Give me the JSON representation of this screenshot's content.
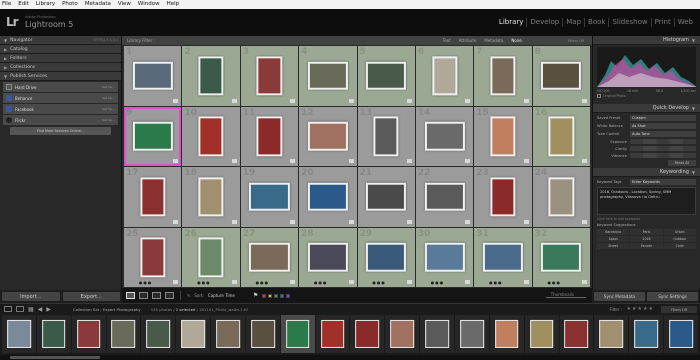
{
  "menu": [
    "File",
    "Edit",
    "Library",
    "Photo",
    "Metadata",
    "View",
    "Window",
    "Help"
  ],
  "identity": {
    "logo": "Lr",
    "small": "Adobe Photoshop",
    "name": "Lightroom 5"
  },
  "modules": [
    {
      "label": "Library",
      "active": true
    },
    {
      "label": "Develop",
      "active": false
    },
    {
      "label": "Map",
      "active": false
    },
    {
      "label": "Book",
      "active": false
    },
    {
      "label": "Slideshow",
      "active": false
    },
    {
      "label": "Print",
      "active": false
    },
    {
      "label": "Web",
      "active": false
    }
  ],
  "left_panel": {
    "navigator": {
      "title": "Navigator",
      "fit": "FIT  FILL  1:1  3:1"
    },
    "sections": [
      "Catalog",
      "Folders",
      "Collections",
      "Publish Services"
    ],
    "services": [
      {
        "label": "Hard Drive",
        "set_up": "Set Up...",
        "icon": "hard-drive-icon"
      },
      {
        "label": "Behance",
        "set_up": "Set Up...",
        "icon": "behance-icon"
      },
      {
        "label": "Facebook",
        "set_up": "Set Up...",
        "icon": "facebook-icon"
      },
      {
        "label": "Flickr",
        "set_up": "Set Up...",
        "icon": "flickr-icon"
      }
    ],
    "find_more": "Find More Services Online..."
  },
  "left_buttons": {
    "import": "Import...",
    "export": "Export..."
  },
  "filter_bar": {
    "title": "Library Filter :",
    "options": [
      {
        "label": "Text",
        "on": false
      },
      {
        "label": "Attribute",
        "on": false
      },
      {
        "label": "Metadata",
        "on": false
      },
      {
        "label": "None",
        "on": true
      }
    ],
    "filters_off": "Filters Off"
  },
  "grid": {
    "cells": [
      {
        "num": "1",
        "photo": "#5a6a7a",
        "shape": "wide",
        "green": false
      },
      {
        "num": "2",
        "photo": "#3a5a4a",
        "shape": "tall",
        "green": true
      },
      {
        "num": "3",
        "photo": "#8b3a3a",
        "shape": "tall",
        "green": true
      },
      {
        "num": "4",
        "photo": "#6a6a5a",
        "shape": "wide",
        "green": true
      },
      {
        "num": "5",
        "photo": "#4a5a4a",
        "shape": "wide",
        "green": true
      },
      {
        "num": "6",
        "photo": "#b0a898",
        "shape": "tall",
        "green": true
      },
      {
        "num": "7",
        "photo": "#7a6a5a",
        "shape": "tall",
        "green": true
      },
      {
        "num": "8",
        "photo": "#5a5040",
        "shape": "wide",
        "green": true
      },
      {
        "num": "9",
        "photo": "#2a7a4a",
        "shape": "wide",
        "green": false,
        "highlight": true
      },
      {
        "num": "10",
        "photo": "#a03028",
        "shape": "tall",
        "green": false
      },
      {
        "num": "11",
        "photo": "#8a2a2a",
        "shape": "tall",
        "green": false
      },
      {
        "num": "12",
        "photo": "#a07060",
        "shape": "wide",
        "green": false
      },
      {
        "num": "13",
        "photo": "#5a5a5a",
        "shape": "tall",
        "green": false
      },
      {
        "num": "14",
        "photo": "#6a6a6a",
        "shape": "wide",
        "green": false
      },
      {
        "num": "15",
        "photo": "#c08060",
        "shape": "tall",
        "green": false
      },
      {
        "num": "16",
        "photo": "#a09060",
        "shape": "tall",
        "green": true
      },
      {
        "num": "17",
        "photo": "#8a3030",
        "shape": "tall",
        "green": false
      },
      {
        "num": "18",
        "photo": "#a09070",
        "shape": "tall",
        "green": false
      },
      {
        "num": "19",
        "photo": "#3a6a8a",
        "shape": "wide",
        "green": false
      },
      {
        "num": "20",
        "photo": "#2a5a8a",
        "shape": "wide",
        "green": false
      },
      {
        "num": "21",
        "photo": "#4a4a4a",
        "shape": "wide",
        "green": false
      },
      {
        "num": "22",
        "photo": "#5a5a5a",
        "shape": "wide",
        "green": false
      },
      {
        "num": "23",
        "photo": "#8a2a2a",
        "shape": "tall",
        "green": false
      },
      {
        "num": "24",
        "photo": "#9a9080",
        "shape": "tall",
        "green": false
      },
      {
        "num": "25",
        "photo": "#8a3a3a",
        "shape": "tall",
        "green": false
      },
      {
        "num": "26",
        "photo": "#6a8a6a",
        "shape": "tall",
        "green": true
      },
      {
        "num": "27",
        "photo": "#7a6a5a",
        "shape": "wide",
        "green": true
      },
      {
        "num": "28",
        "photo": "#4a4a5a",
        "shape": "wide",
        "green": true
      },
      {
        "num": "29",
        "photo": "#3a5a7a",
        "shape": "wide",
        "green": true
      },
      {
        "num": "30",
        "photo": "#5a7a9a",
        "shape": "wide",
        "green": true
      },
      {
        "num": "31",
        "photo": "#4a6a8a",
        "shape": "wide",
        "green": true
      },
      {
        "num": "32",
        "photo": "#3a7a5a",
        "shape": "wide",
        "green": true
      }
    ]
  },
  "toolbar": {
    "sort_label": "Sort:",
    "sort_value": "Capture Time",
    "thumbnails": "Thumbnails",
    "color_labels": [
      "#d23a3a",
      "#e0c23a",
      "#3aa83a",
      "#3a6ad2",
      "#a03ad2"
    ]
  },
  "right_panel": {
    "histogram": {
      "title": "Histogram",
      "iso": "ISO 200",
      "focal": "18 mm",
      "aperture": "f/8.0",
      "shutter": "1/100 sec"
    },
    "original_photo": "Original Photo",
    "quick_develop": {
      "title": "Quick Develop",
      "saved_preset_label": "Saved Preset",
      "saved_preset_value": "Custom",
      "white_balance_label": "White Balance",
      "white_balance_value": "As Shot",
      "tone_control_label": "Tone Control",
      "tone_control_value": "Auto Tone",
      "rows": [
        "Exposure",
        "Clarity",
        "Vibrance"
      ],
      "reset": "Reset All"
    },
    "keywording": {
      "title": "Keywording",
      "tags_label": "Keyword Tags",
      "tags_value": "Enter Keywords",
      "keywords": "2018, Outdoors - Location, Spring, SMM photography, Vilanova i la Geltru",
      "hint": "Click here to add keywords",
      "suggestions_title": "Keyword Suggestions",
      "suggestions": [
        "Barcelona",
        "Paris",
        "Urban",
        "Spain",
        "2018",
        "Outdoor",
        "Street",
        "Facade",
        "Color"
      ]
    }
  },
  "right_buttons": {
    "sync_metadata": "Sync Metadata",
    "sync_settings": "Sync Settings"
  },
  "filmstrip_header": {
    "source": "Collection Set : Expert Photography",
    "count_prefix": "135 photos /",
    "count_selected": "1 selected",
    "file": "/ 181101_Photo_walks-1.tif",
    "filter_label": "Filter :",
    "filter_off": "Filters Off"
  },
  "filmstrip": {
    "frames": [
      "#7a8a9a",
      "#3a5a4a",
      "#8a3a3a",
      "#6a6a5a",
      "#4a5a4a",
      "#b0a898",
      "#7a6a5a",
      "#5a5040",
      "#2a7a4a",
      "#a03028",
      "#8a2a2a",
      "#a07060",
      "#5a5a5a",
      "#6a6a6a",
      "#c08060",
      "#a09060",
      "#8a3030",
      "#a09070",
      "#3a6a8a",
      "#2a5a8a"
    ]
  }
}
